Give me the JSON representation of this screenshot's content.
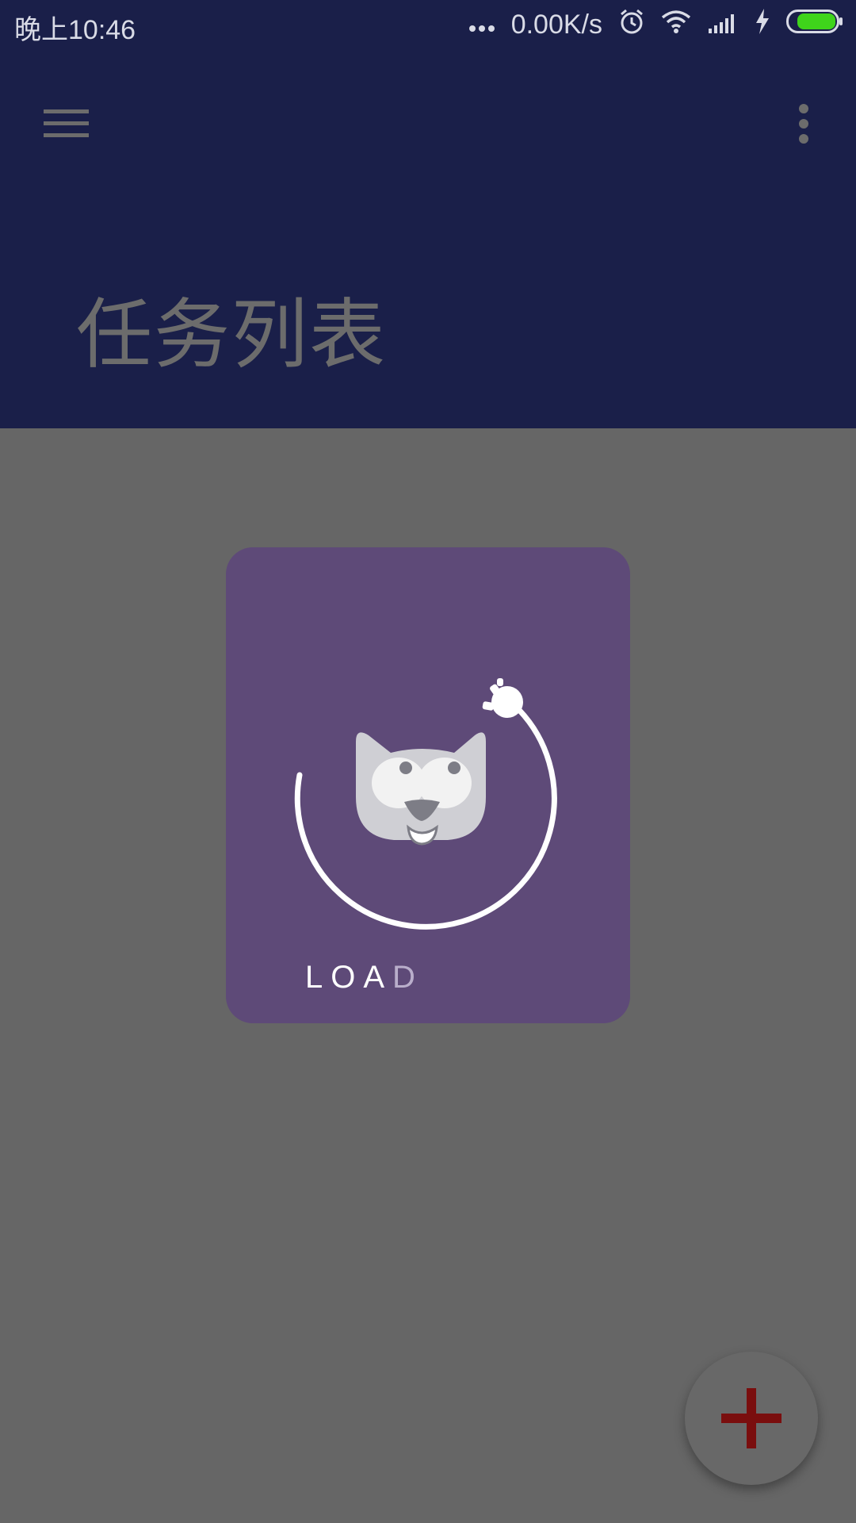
{
  "status_bar": {
    "time": "晚上10:46",
    "network_speed": "0.00K/s",
    "icons": [
      "more-dots-icon",
      "alarm-icon",
      "wifi-icon",
      "signal-icon",
      "charging-icon",
      "battery-icon"
    ],
    "battery_color": "#3fd41b"
  },
  "app_bar": {
    "title": "任务列表",
    "background_color": "#1a1f49",
    "icons": [
      "hamburger-menu-icon",
      "overflow-menu-icon"
    ]
  },
  "loader": {
    "label_prefix": "LOA",
    "label_suffix": "D",
    "card_color": "#5e4a78",
    "icon": "cat-face-icon"
  },
  "fab": {
    "icon": "plus-icon",
    "icon_color": "#7a0e0e"
  }
}
